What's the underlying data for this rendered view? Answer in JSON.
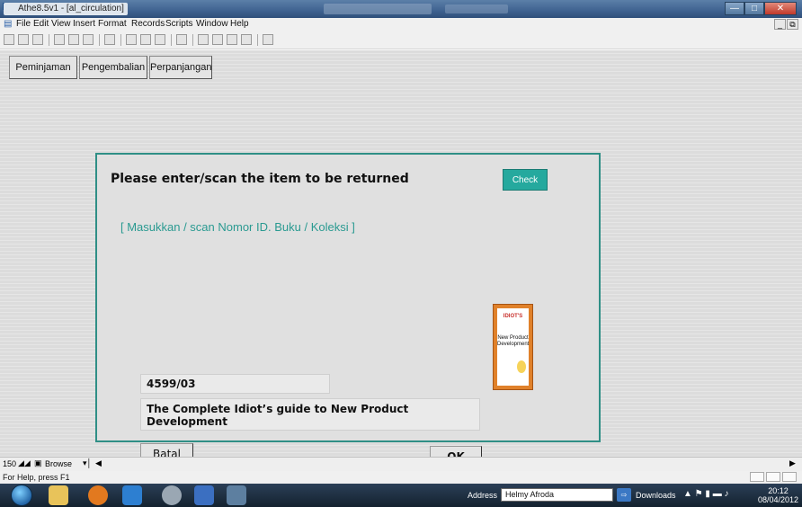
{
  "window": {
    "title": "Athe8.5v1 - [al_circulation]"
  },
  "menu": [
    "File",
    "Edit",
    "View",
    "Insert",
    "Format",
    "Records",
    "Scripts",
    "Window",
    "Help"
  ],
  "tabs": [
    "Peminjaman",
    "Pengembalian",
    "Perpanjangan"
  ],
  "dialog": {
    "prompt": "Please enter/scan the item to be returned",
    "check_label": "Check",
    "hint": "[ Masukkan / scan  Nomor ID. Buku / Koleksi   ]",
    "item_id": "4599/03",
    "item_title": "The Complete Idiot’s guide to New Product Development",
    "cancel_label": "Batal",
    "ok_label": "OK",
    "cover": {
      "brand": "IDIOT'S",
      "title": "New Product Development"
    }
  },
  "navbar": {
    "record_count": "150",
    "mode": "Browse"
  },
  "status": {
    "help_text": "For Help, press F1"
  },
  "taskbar": {
    "address_label": "Address",
    "address_value": "Helmy Afroda",
    "downloads_label": "Downloads",
    "time": "20:12",
    "date": "08/04/2012"
  },
  "colors": {
    "accent": "#25a99e",
    "panel_border": "#2f8f86",
    "hint_text": "#2a9a91"
  }
}
